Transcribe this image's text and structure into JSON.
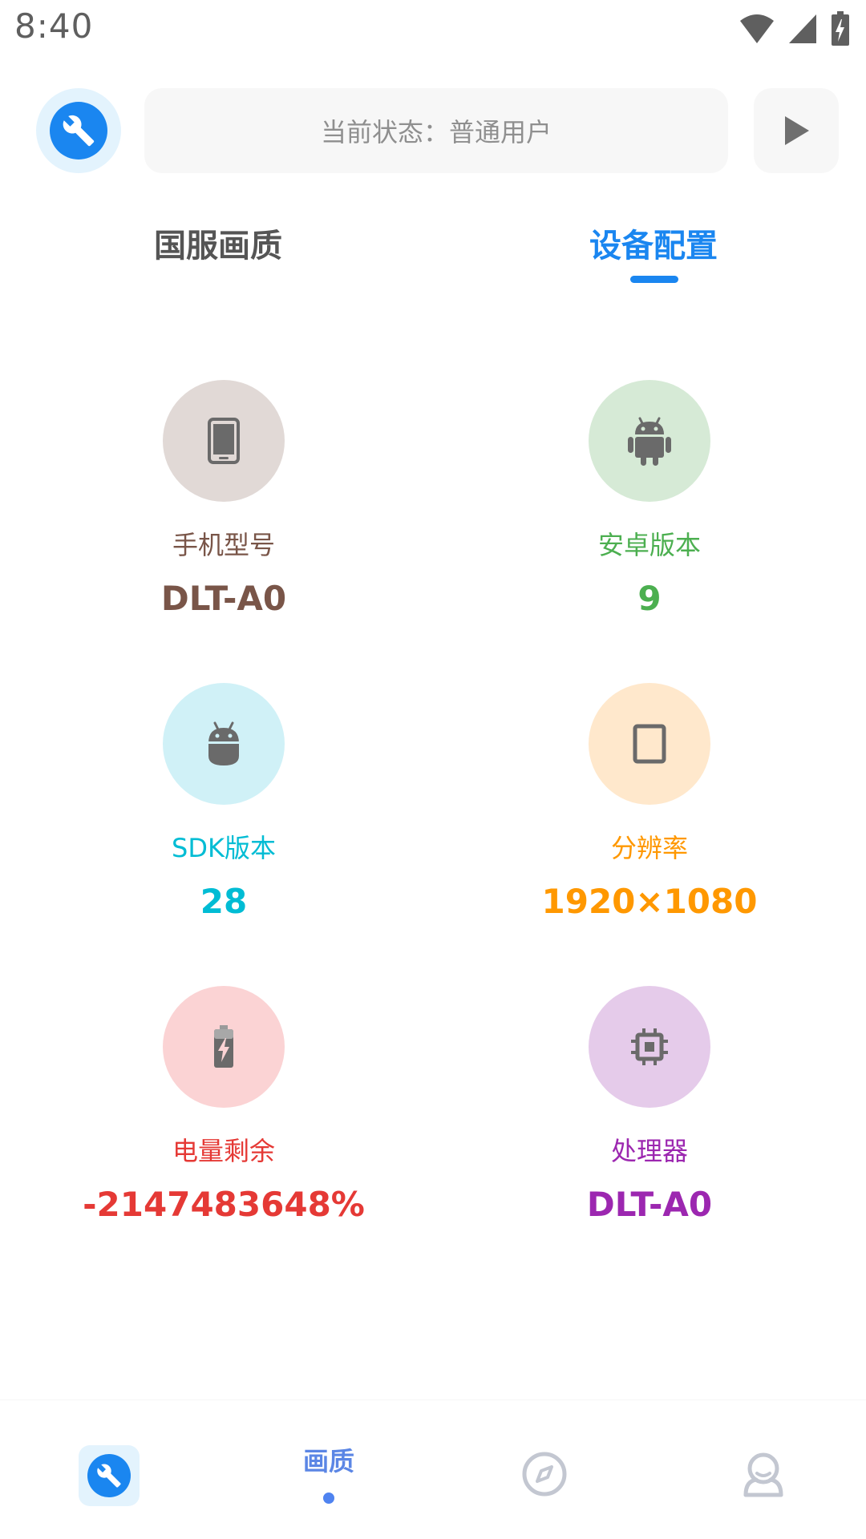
{
  "status_bar": {
    "time": "8:40",
    "icons": [
      "wifi-icon",
      "cell-signal-icon",
      "battery-charging-icon"
    ]
  },
  "header": {
    "avatar_icon": "wrench-icon",
    "status_text": "当前状态：普通用户",
    "play_icon": "play-icon"
  },
  "tabs": [
    {
      "label": "国服画质",
      "active": false
    },
    {
      "label": "设备配置",
      "active": true
    }
  ],
  "device_info": [
    {
      "label": "手机型号",
      "value": "DLT-A0",
      "icon": "phone-icon",
      "color": "#795548",
      "bg": "#e1d9d6"
    },
    {
      "label": "安卓版本",
      "value": "9",
      "icon": "android-icon",
      "color": "#4caf50",
      "bg": "#d6ead6"
    },
    {
      "label": "SDK版本",
      "value": "28",
      "icon": "android-head-icon",
      "color": "#00bcd4",
      "bg": "#d0f1f7"
    },
    {
      "label": "分辨率",
      "value": "1920×1080",
      "icon": "tablet-icon",
      "color": "#ff9800",
      "bg": "#ffe8cc"
    },
    {
      "label": "电量剩余",
      "value": "-2147483648%",
      "icon": "battery-icon",
      "color": "#e53935",
      "bg": "#fbd3d4"
    },
    {
      "label": "处理器",
      "value": "DLT-A0",
      "icon": "cpu-icon",
      "color": "#9c27b0",
      "bg": "#e5cbea"
    }
  ],
  "bottom_nav": {
    "items": [
      {
        "icon": "wrench-icon",
        "label": ""
      },
      {
        "icon": "",
        "label": "画质"
      },
      {
        "icon": "compass-icon",
        "label": ""
      },
      {
        "icon": "profile-icon",
        "label": ""
      }
    ],
    "accent": "#1a86f0"
  }
}
